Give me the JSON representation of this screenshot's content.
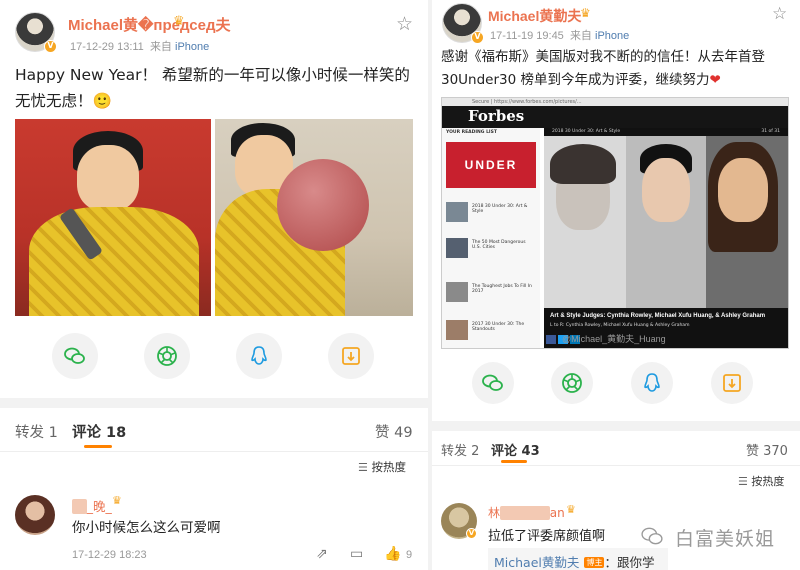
{
  "left": {
    "username": "Michael黄�председ夫",
    "time": "17-12-29 13:11",
    "source_prefix": "来自",
    "source": "iPhone",
    "text_line1": "Happy New Year！ 希望新的一年可以像小时候一样笑的",
    "text_line2": "无忧无虑！🙂",
    "tab_repost": "转发 1",
    "tab_comment": "评论 18",
    "likes": "赞 49",
    "sort": "按热度",
    "comment": {
      "name_visible": "_晚_",
      "text": "你小时候怎么这么可爱啊",
      "time": "17-12-29 18:23",
      "like_count": "9"
    }
  },
  "right": {
    "username": "Michael黄勤夫",
    "time": "17-11-19 19:45",
    "source_prefix": "来自",
    "source": "iPhone",
    "text_line1": "感谢《福布斯》美国版对我不断的的信任！从去年首登",
    "text_line2": "30Under30 榜单到今年成为评委，继续努力",
    "heart": "❤",
    "tab_repost": "转发 2",
    "tab_comment": "评论 43",
    "likes": "赞 370",
    "sort": "按热度",
    "comment": {
      "name_visible_start": "林",
      "name_visible_end": "an",
      "text": "拉低了评委席颜值啊",
      "reply_name": "Michael黄勤夫",
      "reply_tag": "博主",
      "reply_text": "：跟你学的🙂"
    },
    "forbes": {
      "logo": "Forbes",
      "url": "Secure | https://www.forbes.com/pictures/...",
      "sidebar_heading": "YOUR READING LIST",
      "under_text": "UNDER",
      "sub": "2018 30 Under 30: Art & Style",
      "slide": "31 of 31",
      "items": [
        "2018 30 Under 30: Art & Style",
        "The 50 Most Dangerous U.S. Cities",
        "The Toughest Jobs To Fill In 2017",
        "2017 30 Under 30: The Standouts"
      ],
      "caption": "Art & Style Judges: Cynthia Rowley, Michael Xufu Huang, & Ashley Graham",
      "names": "L to R: Cynthia Rowley, Michael Xufu Huang & Ashley Graham",
      "watermark": "@Michael_黄勤夫_Huang"
    }
  },
  "watermark": "白富美妖姐",
  "colors": {
    "accent": "#ff8200",
    "username": "#eb7350",
    "link": "#507daf"
  }
}
